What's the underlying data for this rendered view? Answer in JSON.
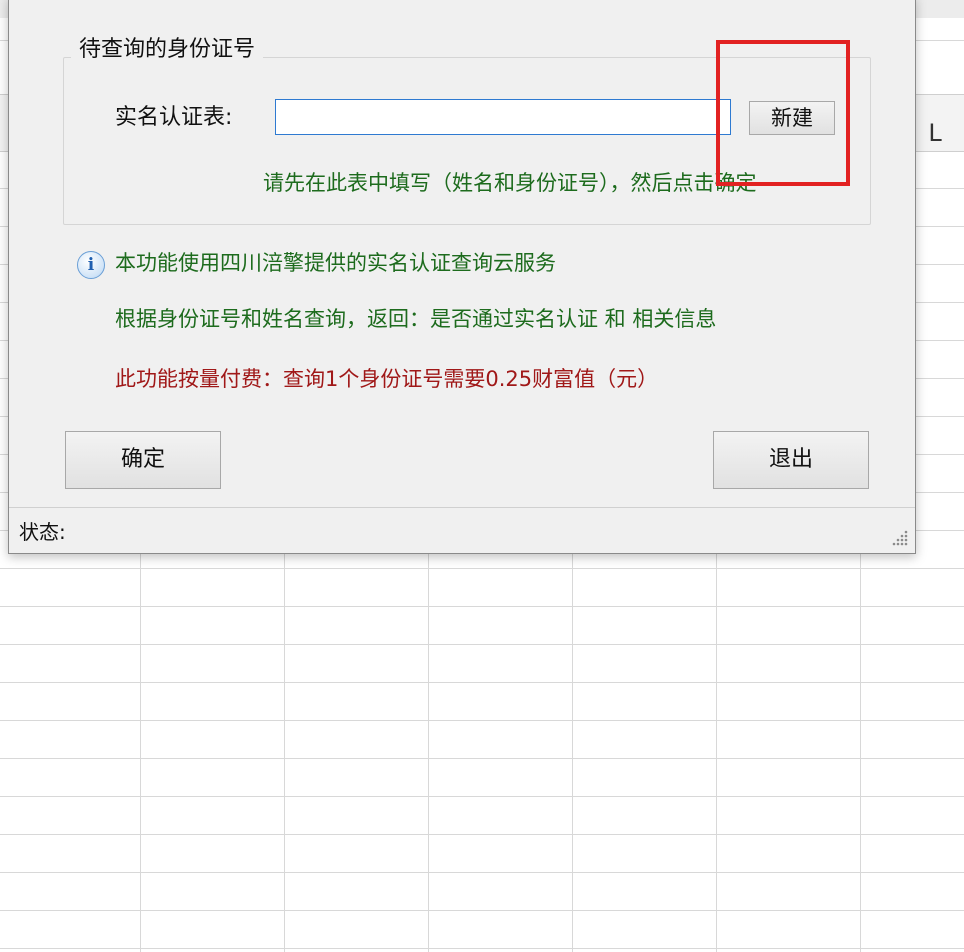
{
  "sheet": {
    "column_label": "L"
  },
  "dialog": {
    "group_title": "待查询的身份证号",
    "field_label": "实名认证表:",
    "field_value": "",
    "new_button": "新建",
    "hint": "请先在此表中填写（姓名和身份证号），然后点击确定",
    "info_icon": "info-icon",
    "info_line1": "本功能使用四川涪擎提供的实名认证查询云服务",
    "info_line2": "根据身份证号和姓名查询，返回：是否通过实名认证 和 相关信息",
    "info_line3": "此功能按量付费：查询1个身份证号需要0.25财富值（元）",
    "ok_button": "确定",
    "exit_button": "退出",
    "status_label": "状态:"
  },
  "colors": {
    "hint_green": "#1d6b1d",
    "price_red": "#a01818",
    "highlight_red": "#e22222",
    "input_border": "#2e7ad1"
  }
}
